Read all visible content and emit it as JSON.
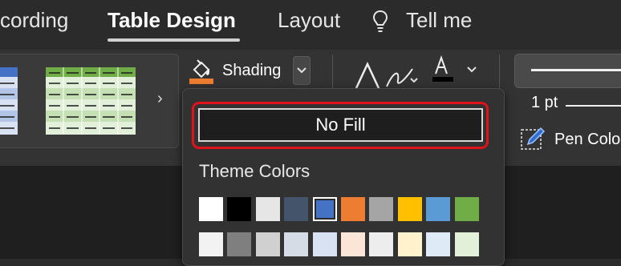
{
  "tabs": {
    "recording": "cording",
    "table_design": "Table Design",
    "layout": "Layout",
    "tell_me": "Tell me"
  },
  "ribbon": {
    "shading_label": "Shading",
    "pen_weight": "1 pt",
    "pen_color_label": "Pen Colo"
  },
  "shading_menu": {
    "no_fill_label": "No Fill",
    "theme_colors_heading": "Theme Colors",
    "theme_colors_row1": [
      "#ffffff",
      "#000000",
      "#e6e6e6",
      "#44546a",
      "#4472c4",
      "#ed7d31",
      "#a5a5a5",
      "#ffc000",
      "#5b9bd5",
      "#70ad47"
    ],
    "theme_colors_row2": [
      "#f2f2f2",
      "#7f7f7f",
      "#d0d0d0",
      "#d6dce5",
      "#d9e2f3",
      "#fbe5d6",
      "#ededed",
      "#fff2cc",
      "#deebf7",
      "#e2f0d9"
    ],
    "selected_color": "#4472c4"
  },
  "colors": {
    "highlight": "#e0121b",
    "shading_accent": "#ed7d31",
    "table_style_blue": "#4472c4",
    "table_style_green": "#70ad47"
  }
}
